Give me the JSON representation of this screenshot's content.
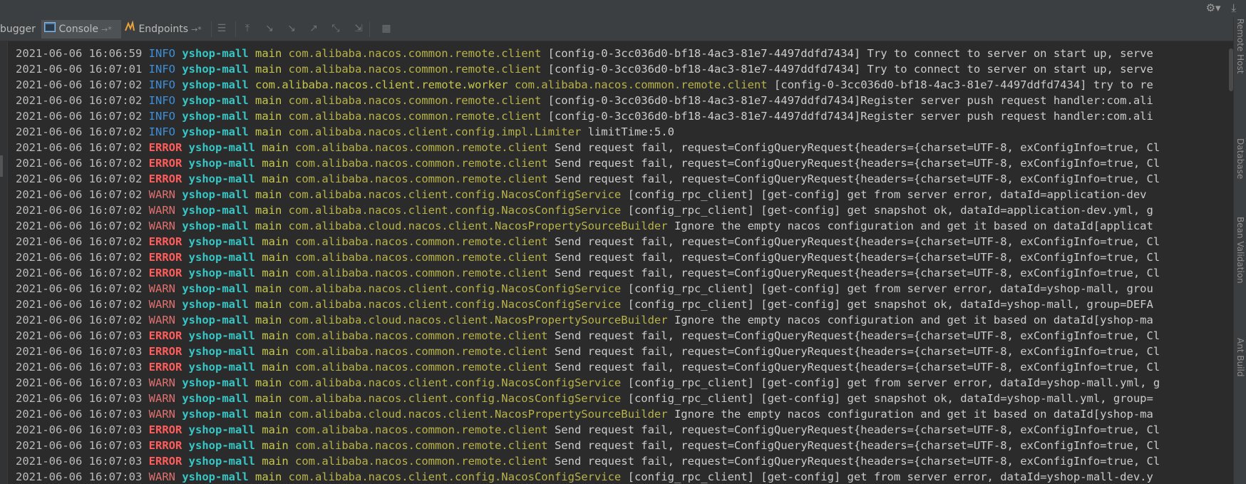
{
  "toolbar": {
    "tabs": [
      {
        "label": "bugger"
      },
      {
        "label": "Console",
        "pin": "→*"
      },
      {
        "label": "Endpoints",
        "pin": "→*"
      }
    ]
  },
  "right_rail": {
    "labels": [
      "Remote Host",
      "Database",
      "Bean Validation",
      "Ant Build"
    ]
  },
  "console": {
    "lines": [
      {
        "ts": "2021-06-06 16:06:59",
        "level": "INFO",
        "app": "yshop-mall",
        "thread": "main",
        "logger": "com.alibaba.nacos.common.remote.client",
        "msg": "[config-0-3cc036d0-bf18-4ac3-81e7-4497ddfd7434] Try to connect to server on start up, serve"
      },
      {
        "ts": "2021-06-06 16:07:01",
        "level": "INFO",
        "app": "yshop-mall",
        "thread": "main",
        "logger": "com.alibaba.nacos.common.remote.client",
        "msg": "[config-0-3cc036d0-bf18-4ac3-81e7-4497ddfd7434] Try to connect to server on start up, serve"
      },
      {
        "ts": "2021-06-06 16:07:02",
        "level": "INFO",
        "app": "yshop-mall",
        "thread": "com.alibaba.nacos.client.remote.worker",
        "logger": "com.alibaba.nacos.common.remote.client",
        "msg": "[config-0-3cc036d0-bf18-4ac3-81e7-4497ddfd7434] try to re"
      },
      {
        "ts": "2021-06-06 16:07:02",
        "level": "INFO",
        "app": "yshop-mall",
        "thread": "main",
        "logger": "com.alibaba.nacos.common.remote.client",
        "msg": "[config-0-3cc036d0-bf18-4ac3-81e7-4497ddfd7434]Register server push request handler:com.ali"
      },
      {
        "ts": "2021-06-06 16:07:02",
        "level": "INFO",
        "app": "yshop-mall",
        "thread": "main",
        "logger": "com.alibaba.nacos.common.remote.client",
        "msg": "[config-0-3cc036d0-bf18-4ac3-81e7-4497ddfd7434]Register server push request handler:com.ali"
      },
      {
        "ts": "2021-06-06 16:07:02",
        "level": "INFO",
        "app": "yshop-mall",
        "thread": "main",
        "logger": "com.alibaba.nacos.client.config.impl.Limiter",
        "msg": "limitTime:5.0"
      },
      {
        "ts": "2021-06-06 16:07:02",
        "level": "ERROR",
        "app": "yshop-mall",
        "thread": "main",
        "logger": "com.alibaba.nacos.common.remote.client",
        "msg": "Send request fail, request=ConfigQueryRequest{headers={charset=UTF-8, exConfigInfo=true, Cl"
      },
      {
        "ts": "2021-06-06 16:07:02",
        "level": "ERROR",
        "app": "yshop-mall",
        "thread": "main",
        "logger": "com.alibaba.nacos.common.remote.client",
        "msg": "Send request fail, request=ConfigQueryRequest{headers={charset=UTF-8, exConfigInfo=true, Cl"
      },
      {
        "ts": "2021-06-06 16:07:02",
        "level": "ERROR",
        "app": "yshop-mall",
        "thread": "main",
        "logger": "com.alibaba.nacos.common.remote.client",
        "msg": "Send request fail, request=ConfigQueryRequest{headers={charset=UTF-8, exConfigInfo=true, Cl"
      },
      {
        "ts": "2021-06-06 16:07:02",
        "level": "WARN",
        "app": "yshop-mall",
        "thread": "main",
        "logger": "com.alibaba.nacos.client.config.NacosConfigService",
        "msg": "[config_rpc_client] [get-config] get from server error, dataId=application-dev"
      },
      {
        "ts": "2021-06-06 16:07:02",
        "level": "WARN",
        "app": "yshop-mall",
        "thread": "main",
        "logger": "com.alibaba.nacos.client.config.NacosConfigService",
        "msg": "[config_rpc_client] [get-config] get snapshot ok, dataId=application-dev.yml, g"
      },
      {
        "ts": "2021-06-06 16:07:02",
        "level": "WARN",
        "app": "yshop-mall",
        "thread": "main",
        "logger": "com.alibaba.cloud.nacos.client.NacosPropertySourceBuilder",
        "msg": "Ignore the empty nacos configuration and get it based on dataId[applicat"
      },
      {
        "ts": "2021-06-06 16:07:02",
        "level": "ERROR",
        "app": "yshop-mall",
        "thread": "main",
        "logger": "com.alibaba.nacos.common.remote.client",
        "msg": "Send request fail, request=ConfigQueryRequest{headers={charset=UTF-8, exConfigInfo=true, Cl"
      },
      {
        "ts": "2021-06-06 16:07:02",
        "level": "ERROR",
        "app": "yshop-mall",
        "thread": "main",
        "logger": "com.alibaba.nacos.common.remote.client",
        "msg": "Send request fail, request=ConfigQueryRequest{headers={charset=UTF-8, exConfigInfo=true, Cl"
      },
      {
        "ts": "2021-06-06 16:07:02",
        "level": "ERROR",
        "app": "yshop-mall",
        "thread": "main",
        "logger": "com.alibaba.nacos.common.remote.client",
        "msg": "Send request fail, request=ConfigQueryRequest{headers={charset=UTF-8, exConfigInfo=true, Cl"
      },
      {
        "ts": "2021-06-06 16:07:02",
        "level": "WARN",
        "app": "yshop-mall",
        "thread": "main",
        "logger": "com.alibaba.nacos.client.config.NacosConfigService",
        "msg": "[config_rpc_client] [get-config] get from server error, dataId=yshop-mall, grou"
      },
      {
        "ts": "2021-06-06 16:07:02",
        "level": "WARN",
        "app": "yshop-mall",
        "thread": "main",
        "logger": "com.alibaba.nacos.client.config.NacosConfigService",
        "msg": "[config_rpc_client] [get-config] get snapshot ok, dataId=yshop-mall, group=DEFA"
      },
      {
        "ts": "2021-06-06 16:07:02",
        "level": "WARN",
        "app": "yshop-mall",
        "thread": "main",
        "logger": "com.alibaba.cloud.nacos.client.NacosPropertySourceBuilder",
        "msg": "Ignore the empty nacos configuration and get it based on dataId[yshop-ma"
      },
      {
        "ts": "2021-06-06 16:07:03",
        "level": "ERROR",
        "app": "yshop-mall",
        "thread": "main",
        "logger": "com.alibaba.nacos.common.remote.client",
        "msg": "Send request fail, request=ConfigQueryRequest{headers={charset=UTF-8, exConfigInfo=true, Cl"
      },
      {
        "ts": "2021-06-06 16:07:03",
        "level": "ERROR",
        "app": "yshop-mall",
        "thread": "main",
        "logger": "com.alibaba.nacos.common.remote.client",
        "msg": "Send request fail, request=ConfigQueryRequest{headers={charset=UTF-8, exConfigInfo=true, Cl"
      },
      {
        "ts": "2021-06-06 16:07:03",
        "level": "ERROR",
        "app": "yshop-mall",
        "thread": "main",
        "logger": "com.alibaba.nacos.common.remote.client",
        "msg": "Send request fail, request=ConfigQueryRequest{headers={charset=UTF-8, exConfigInfo=true, Cl"
      },
      {
        "ts": "2021-06-06 16:07:03",
        "level": "WARN",
        "app": "yshop-mall",
        "thread": "main",
        "logger": "com.alibaba.nacos.client.config.NacosConfigService",
        "msg": "[config_rpc_client] [get-config] get from server error, dataId=yshop-mall.yml, g"
      },
      {
        "ts": "2021-06-06 16:07:03",
        "level": "WARN",
        "app": "yshop-mall",
        "thread": "main",
        "logger": "com.alibaba.nacos.client.config.NacosConfigService",
        "msg": "[config_rpc_client] [get-config] get snapshot ok, dataId=yshop-mall.yml, group="
      },
      {
        "ts": "2021-06-06 16:07:03",
        "level": "WARN",
        "app": "yshop-mall",
        "thread": "main",
        "logger": "com.alibaba.cloud.nacos.client.NacosPropertySourceBuilder",
        "msg": "Ignore the empty nacos configuration and get it based on dataId[yshop-ma"
      },
      {
        "ts": "2021-06-06 16:07:03",
        "level": "ERROR",
        "app": "yshop-mall",
        "thread": "main",
        "logger": "com.alibaba.nacos.common.remote.client",
        "msg": "Send request fail, request=ConfigQueryRequest{headers={charset=UTF-8, exConfigInfo=true, Cl"
      },
      {
        "ts": "2021-06-06 16:07:03",
        "level": "ERROR",
        "app": "yshop-mall",
        "thread": "main",
        "logger": "com.alibaba.nacos.common.remote.client",
        "msg": "Send request fail, request=ConfigQueryRequest{headers={charset=UTF-8, exConfigInfo=true, Cl"
      },
      {
        "ts": "2021-06-06 16:07:03",
        "level": "ERROR",
        "app": "yshop-mall",
        "thread": "main",
        "logger": "com.alibaba.nacos.common.remote.client",
        "msg": "Send request fail, request=ConfigQueryRequest{headers={charset=UTF-8, exConfigInfo=true, Cl"
      },
      {
        "ts": "2021-06-06 16:07:03",
        "level": "WARN",
        "app": "yshop-mall",
        "thread": "main",
        "logger": "com.alibaba.nacos.client.config.NacosConfigService",
        "msg": "[config_rpc_client] [get-config] get from server error, dataId=yshop-mall-dev.y"
      }
    ]
  }
}
